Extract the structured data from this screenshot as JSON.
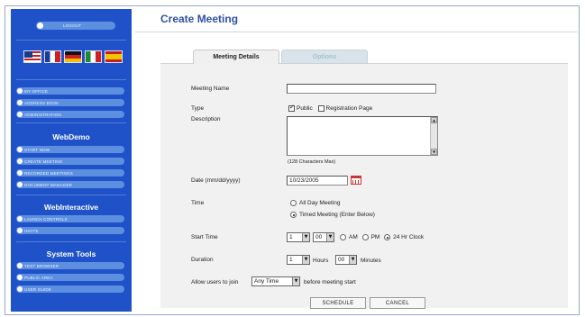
{
  "sidebar": {
    "logout_label": "LOGOUT",
    "top_links": [
      "MY OFFICE",
      "ADDRESS BOOK",
      "ADMINISTRATION"
    ],
    "sections": [
      {
        "title": "WebDemo",
        "items": [
          "START NOW",
          "CREATE MEETING",
          "RECORDED MEETINGS",
          "DOCUMENT MANAGER"
        ]
      },
      {
        "title": "WebInteractive",
        "items": [
          "LAUNCH CONTROLS",
          "INVITE"
        ]
      },
      {
        "title": "System Tools",
        "items": [
          "TEST BROWSER",
          "PUBLIC AREA",
          "USER GUIDE"
        ]
      }
    ],
    "flags": [
      "us-flag-icon",
      "france-flag-icon",
      "germany-flag-icon",
      "italy-flag-icon",
      "spain-flag-icon"
    ],
    "accent": "#1f52c8"
  },
  "page": {
    "title": "Create Meeting"
  },
  "tabs": [
    {
      "label": "Meeting Details",
      "active": true
    },
    {
      "label": "Options",
      "active": false
    }
  ],
  "form": {
    "meeting_name": {
      "label": "Meeting Name",
      "value": ""
    },
    "type": {
      "label": "Type",
      "public_label": "Public",
      "public_checked": true,
      "registration_label": "Registration Page",
      "registration_checked": false
    },
    "description": {
      "label": "Description",
      "value": "",
      "hint": "(128 Characters Max)"
    },
    "date": {
      "label": "Date (mm/dd/yyyy)",
      "value": "10/23/2005"
    },
    "time": {
      "label": "Time",
      "all_day_label": "All Day Meeting",
      "timed_label": "Timed Meeting (Enter Below)",
      "selected": "timed"
    },
    "start_time": {
      "label": "Start Time",
      "hour": "1",
      "minute": "00",
      "am_label": "AM",
      "pm_label": "PM",
      "h24_label": "24 Hr Clock",
      "selected": "24hr"
    },
    "duration": {
      "label": "Duration",
      "hours": "1",
      "hours_label": "Hours",
      "minutes": "00",
      "minutes_label": "Minutes"
    },
    "join": {
      "prefix": "Allow users to join",
      "value": "Any Time",
      "suffix": "before meeting start"
    }
  },
  "buttons": {
    "schedule": "SCHEDULE",
    "cancel": "CANCEL"
  }
}
